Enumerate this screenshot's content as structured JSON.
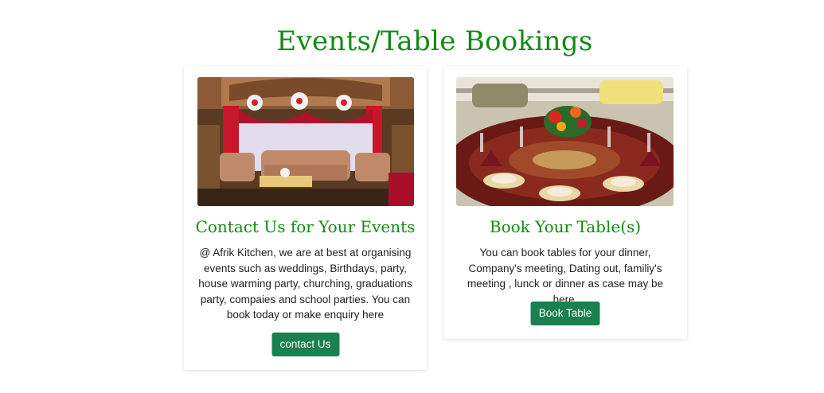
{
  "page": {
    "title": "Events/Table Bookings"
  },
  "cards": [
    {
      "image": "event-stage-photo",
      "title": "Contact Us for Your Events",
      "text": "@ Afrik Kitchen, we are at best at organising events such as weddings, Birthdays, party, house warming party, churching, graduations party, compaies and school parties. You can book today or make enquiry here",
      "button_label": "contact Us"
    },
    {
      "image": "dining-table-photo",
      "title": "Book Your Table(s)",
      "text": "You can book tables for your dinner, Company's meeting, Dating out, familiy's meeting , lunck or dinner as case may be here.",
      "button_label": "Book Table"
    }
  ],
  "colors": {
    "title_green": "#138a13",
    "button_green": "#1a8050"
  }
}
